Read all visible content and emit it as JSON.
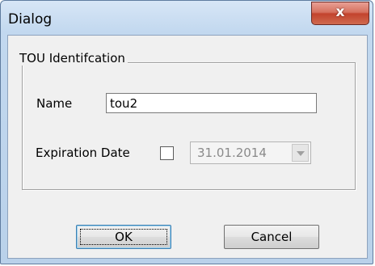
{
  "window": {
    "title": "Dialog",
    "close_label": "x"
  },
  "group": {
    "title": "TOU Identifcation"
  },
  "name_field": {
    "label": "Name",
    "value": "tou2"
  },
  "expiration": {
    "label": "Expiration Date",
    "checked": false,
    "date_value": "31.01.2014",
    "enabled": false
  },
  "buttons": {
    "ok_label": "OK",
    "cancel_label": "Cancel"
  },
  "colors": {
    "titlebar": "#c2d8ef",
    "close_button": "#c2432d",
    "client_background": "#f0f0f0"
  }
}
